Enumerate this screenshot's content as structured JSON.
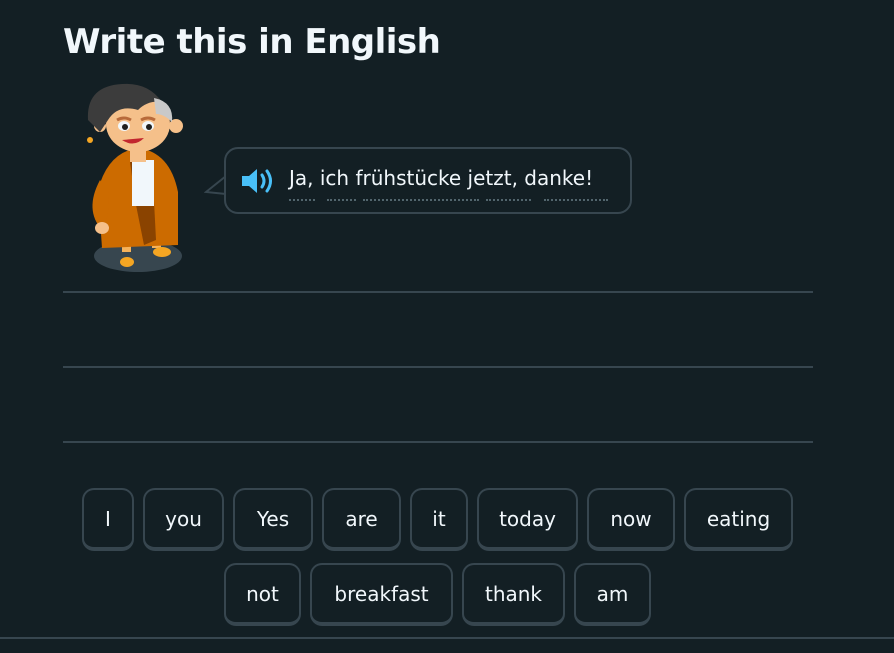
{
  "header": {
    "title": "Write this in English"
  },
  "prompt": {
    "character_icon": "cartoon-character",
    "audio_icon": "speaker-icon",
    "sentence": "Ja, ich frühstücke jetzt, danke!"
  },
  "word_bank": {
    "row1": [
      "I",
      "you",
      "Yes",
      "are",
      "it",
      "today",
      "now",
      "eating"
    ],
    "row2": [
      "not",
      "breakfast",
      "thank",
      "am"
    ]
  },
  "colors": {
    "background": "#131f24",
    "border": "#37464f",
    "text": "#f1f7fb",
    "speaker": "#49c0f8",
    "jacket": "#cc6b00"
  }
}
